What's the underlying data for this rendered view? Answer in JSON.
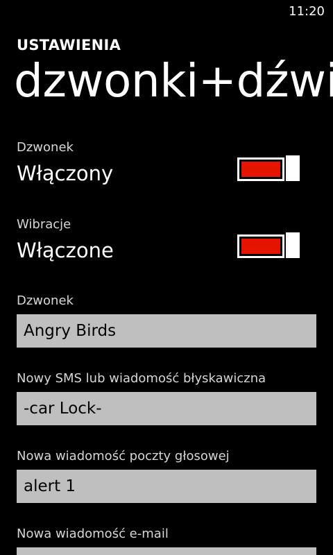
{
  "status_bar": {
    "time": "11:20"
  },
  "header": {
    "app_title": "USTAWIENIA",
    "page_title": "dzwonki+dźwięki"
  },
  "settings": {
    "ringer_toggle": {
      "label": "Dzwonek",
      "value": "Włączony",
      "on": true
    },
    "vibration_toggle": {
      "label": "Wibracje",
      "value": "Włączone",
      "on": true
    },
    "ringtone": {
      "label": "Dzwonek",
      "value": "Angry Birds"
    },
    "sms_tone": {
      "label": "Nowy SMS lub wiadomość błyskawiczna",
      "value": "-car Lock-"
    },
    "voicemail_tone": {
      "label": "Nowa wiadomość poczty głosowej",
      "value": "alert 1"
    },
    "email_tone": {
      "label": "Nowa wiadomość e-mail",
      "value": ""
    }
  },
  "colors": {
    "accent": "#e51400",
    "background": "#000000",
    "picker_background": "#bfbfbf"
  }
}
